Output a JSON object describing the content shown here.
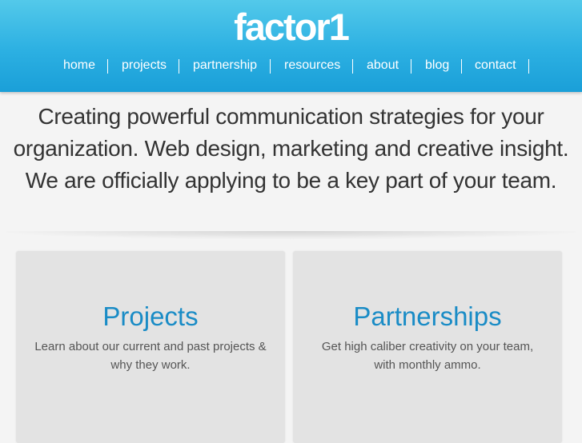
{
  "header": {
    "logo": "factor1",
    "nav": [
      {
        "label": "home"
      },
      {
        "label": "projects"
      },
      {
        "label": "partnership"
      },
      {
        "label": "resources"
      },
      {
        "label": "about"
      },
      {
        "label": "blog"
      },
      {
        "label": "contact"
      }
    ]
  },
  "hero": {
    "lines": [
      "Creating powerful communication strategies for your",
      "organization. Web design, marketing and creative insight.",
      "We are officially applying to be a key part of your team."
    ]
  },
  "cards": [
    {
      "title": "Projects",
      "lines": [
        "Learn about our current and past projects &",
        "why they work."
      ]
    },
    {
      "title": "Partnerships",
      "lines": [
        "Get high caliber creativity on your team,",
        "with monthly ammo."
      ]
    }
  ],
  "colors": {
    "header_top": "#53c9ea",
    "header_bottom": "#1a9fd8",
    "card_title": "#1a8cc6",
    "hero_text": "#333333",
    "card_bg": "#e3e3e3",
    "page_bg": "#f4f4f4"
  }
}
